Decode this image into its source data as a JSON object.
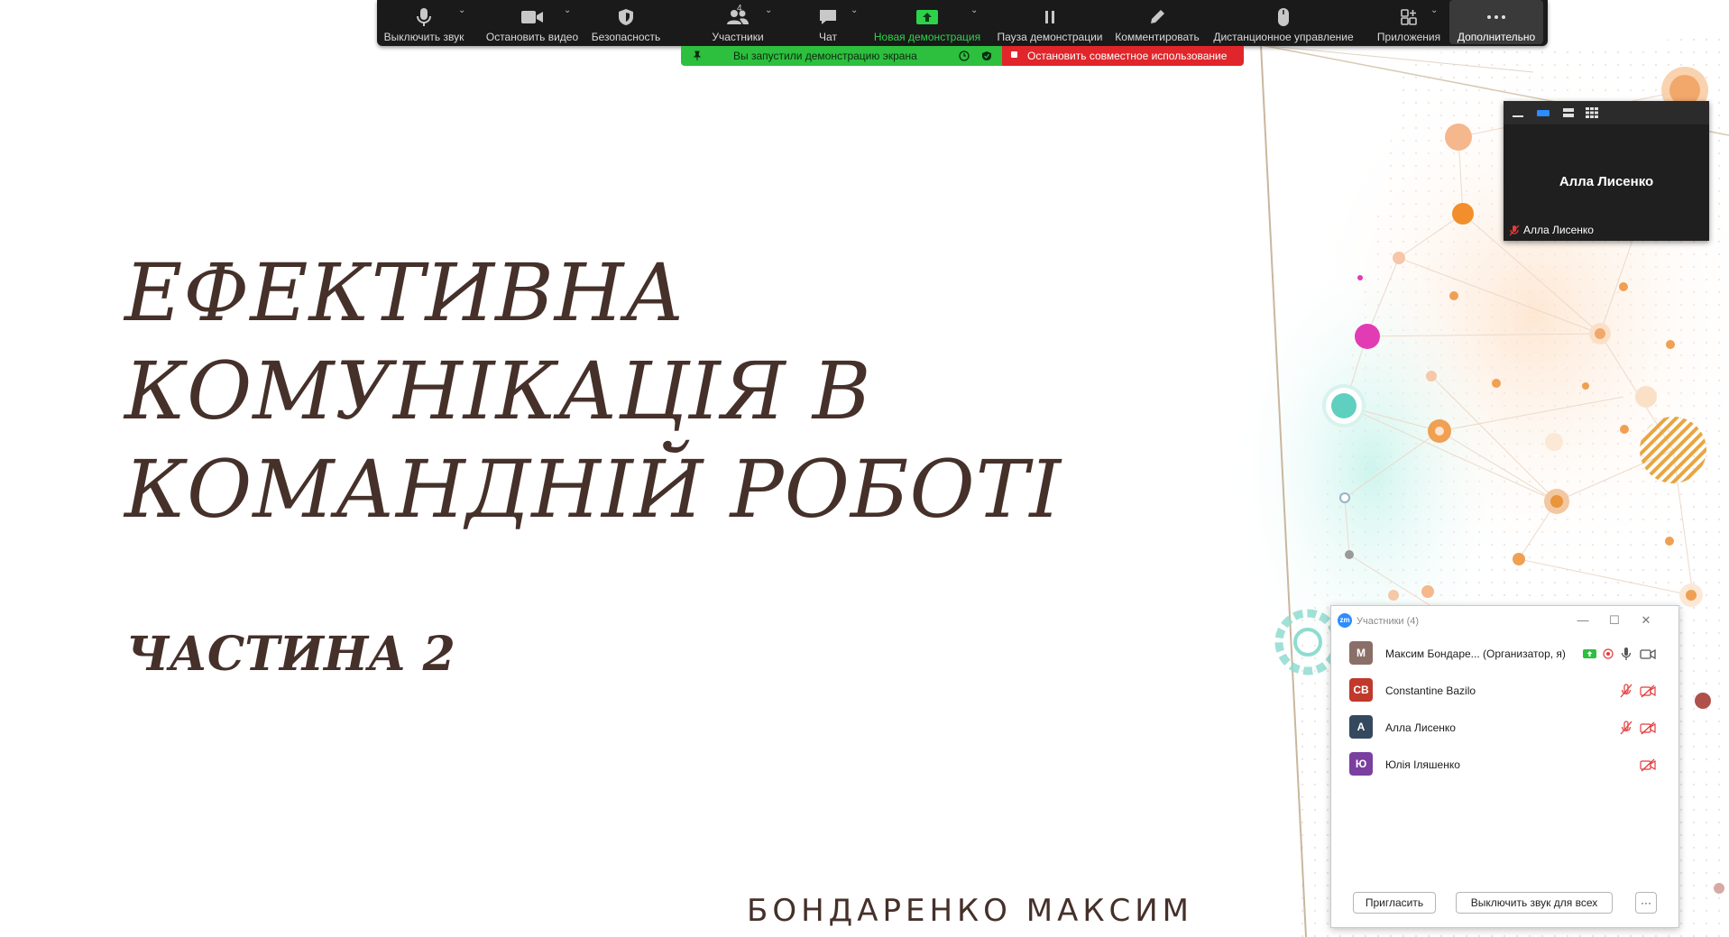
{
  "toolbar": {
    "items": [
      {
        "label": "Выключить звук",
        "icon": "microphone-icon"
      },
      {
        "label": "Остановить видео",
        "icon": "video-camera-icon"
      },
      {
        "label": "Безопасность",
        "icon": "shield-icon"
      },
      {
        "label": "Участники",
        "icon": "participants-icon",
        "count": "4"
      },
      {
        "label": "Чат",
        "icon": "chat-bubble-icon"
      },
      {
        "label": "Новая демонстрация",
        "icon": "share-screen-icon"
      },
      {
        "label": "Пауза демонстрации",
        "icon": "pause-icon"
      },
      {
        "label": "Комментировать",
        "icon": "pencil-icon"
      },
      {
        "label": "Дистанционное управление",
        "icon": "mouse-icon"
      },
      {
        "label": "Приложения",
        "icon": "apps-icon"
      },
      {
        "label": "Дополнительно",
        "icon": "more-dots-icon"
      }
    ],
    "colors": {
      "background": "#1a1a1a",
      "share_green": "#2dd24a",
      "label": "#d9d9d9"
    }
  },
  "share_banner": {
    "status_text": "Вы запустили демонстрацию экрана",
    "stop_text": "Остановить совместное использование",
    "colors": {
      "green": "#2dbf3e",
      "red": "#e0262a"
    }
  },
  "video_panel": {
    "name": "Алла Лисенко",
    "footer_name": "Алла Лисенко"
  },
  "participants_panel": {
    "title": "Участники (4)",
    "logo": "zm",
    "participants": [
      {
        "initials": "М",
        "name": "Максим Бондаре... (Организатор, я)",
        "avatar_color": "#8a6f68",
        "audio": "on",
        "video": "on"
      },
      {
        "initials": "CB",
        "name": "Constantine Bazilo",
        "avatar_color": "#c0392b",
        "audio": "muted",
        "video": "off"
      },
      {
        "initials": "А",
        "name": "Алла Лисенко",
        "avatar_color": "#34495e",
        "audio": "muted",
        "video": "off"
      },
      {
        "initials": "Ю",
        "name": "Юлія Іляшенко",
        "avatar_color": "#7b3fa0",
        "audio": "none",
        "video": "off"
      }
    ],
    "invite_label": "Пригласить",
    "mute_all_label": "Выключить звук для всех",
    "more_label": "···"
  },
  "slide": {
    "title_lines": [
      "ЕФЕКТИВНА",
      "КОМУНІКАЦІЯ В",
      "КОМАНДНІЙ РОБОТІ"
    ],
    "subtitle": "ЧАСТИНА 2",
    "author": "БОНДАРЕНКО МАКСИМ",
    "colors": {
      "text": "#45302a",
      "accent_orange": "#f0a052",
      "accent_teal": "#5fcfc0",
      "accent_magenta": "#e23cb4"
    }
  }
}
